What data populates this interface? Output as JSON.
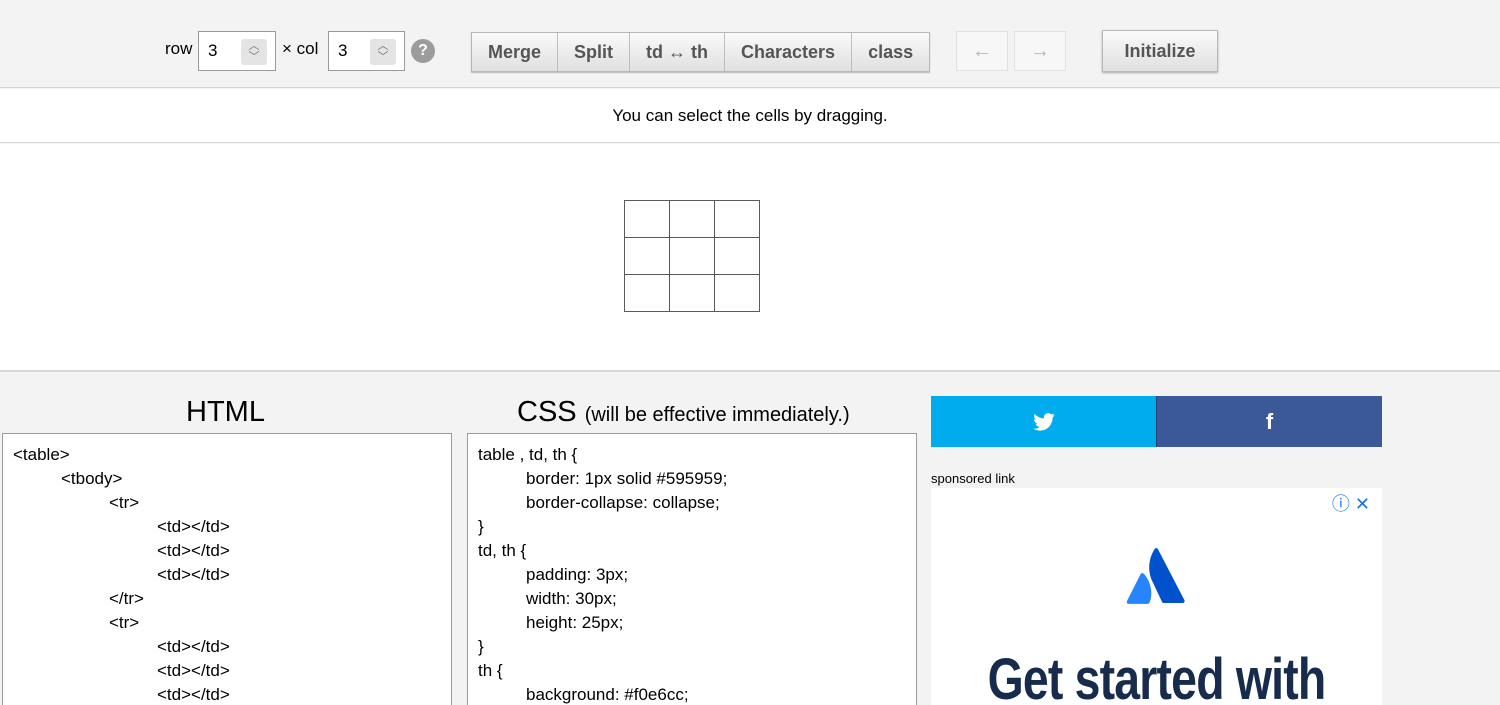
{
  "toolbar": {
    "row_label": "row",
    "row_value": "3",
    "col_label": "× col",
    "col_value": "3",
    "help": "?",
    "buttons": [
      "Merge",
      "Split",
      "td ↔ th",
      "Characters",
      "class"
    ],
    "undo": "←",
    "redo": "→",
    "initialize": "Initialize"
  },
  "hint": "You can select the cells by dragging.",
  "preview": {
    "rows": 3,
    "cols": 3
  },
  "html_panel": {
    "title": "HTML",
    "lines": [
      {
        "text": "<table>",
        "indent": 0
      },
      {
        "text": "<tbody>",
        "indent": 1
      },
      {
        "text": "<tr>",
        "indent": 2
      },
      {
        "text": "<td></td>",
        "indent": 3
      },
      {
        "text": "<td></td>",
        "indent": 3
      },
      {
        "text": "<td></td>",
        "indent": 3
      },
      {
        "text": "</tr>",
        "indent": 2
      },
      {
        "text": "<tr>",
        "indent": 2
      },
      {
        "text": "<td></td>",
        "indent": 3
      },
      {
        "text": "<td></td>",
        "indent": 3
      },
      {
        "text": "<td></td>",
        "indent": 3
      }
    ]
  },
  "css_panel": {
    "title": "CSS",
    "subtitle": "(will be effective immediately.)",
    "lines": [
      {
        "text": "table , td, th {",
        "indent": 0
      },
      {
        "text": "border: 1px solid #595959;",
        "indent": 1
      },
      {
        "text": "border-collapse: collapse;",
        "indent": 1
      },
      {
        "text": "}",
        "indent": 0
      },
      {
        "text": "td, th {",
        "indent": 0
      },
      {
        "text": "padding: 3px;",
        "indent": 1
      },
      {
        "text": "width: 30px;",
        "indent": 1
      },
      {
        "text": "height: 25px;",
        "indent": 1
      },
      {
        "text": "}",
        "indent": 0
      },
      {
        "text": "th {",
        "indent": 0
      },
      {
        "text": "background: #f0e6cc;",
        "indent": 1
      }
    ]
  },
  "social": {
    "twitter_icon": "twitter-bird-icon",
    "facebook": "f"
  },
  "sponsored_label": "sponsored link",
  "ad": {
    "close": "ⓘ ✕",
    "headline": "Get started with"
  },
  "colors": {
    "twitter": "#00acee",
    "facebook": "#3b5998",
    "atlassian": "#2684ff"
  }
}
